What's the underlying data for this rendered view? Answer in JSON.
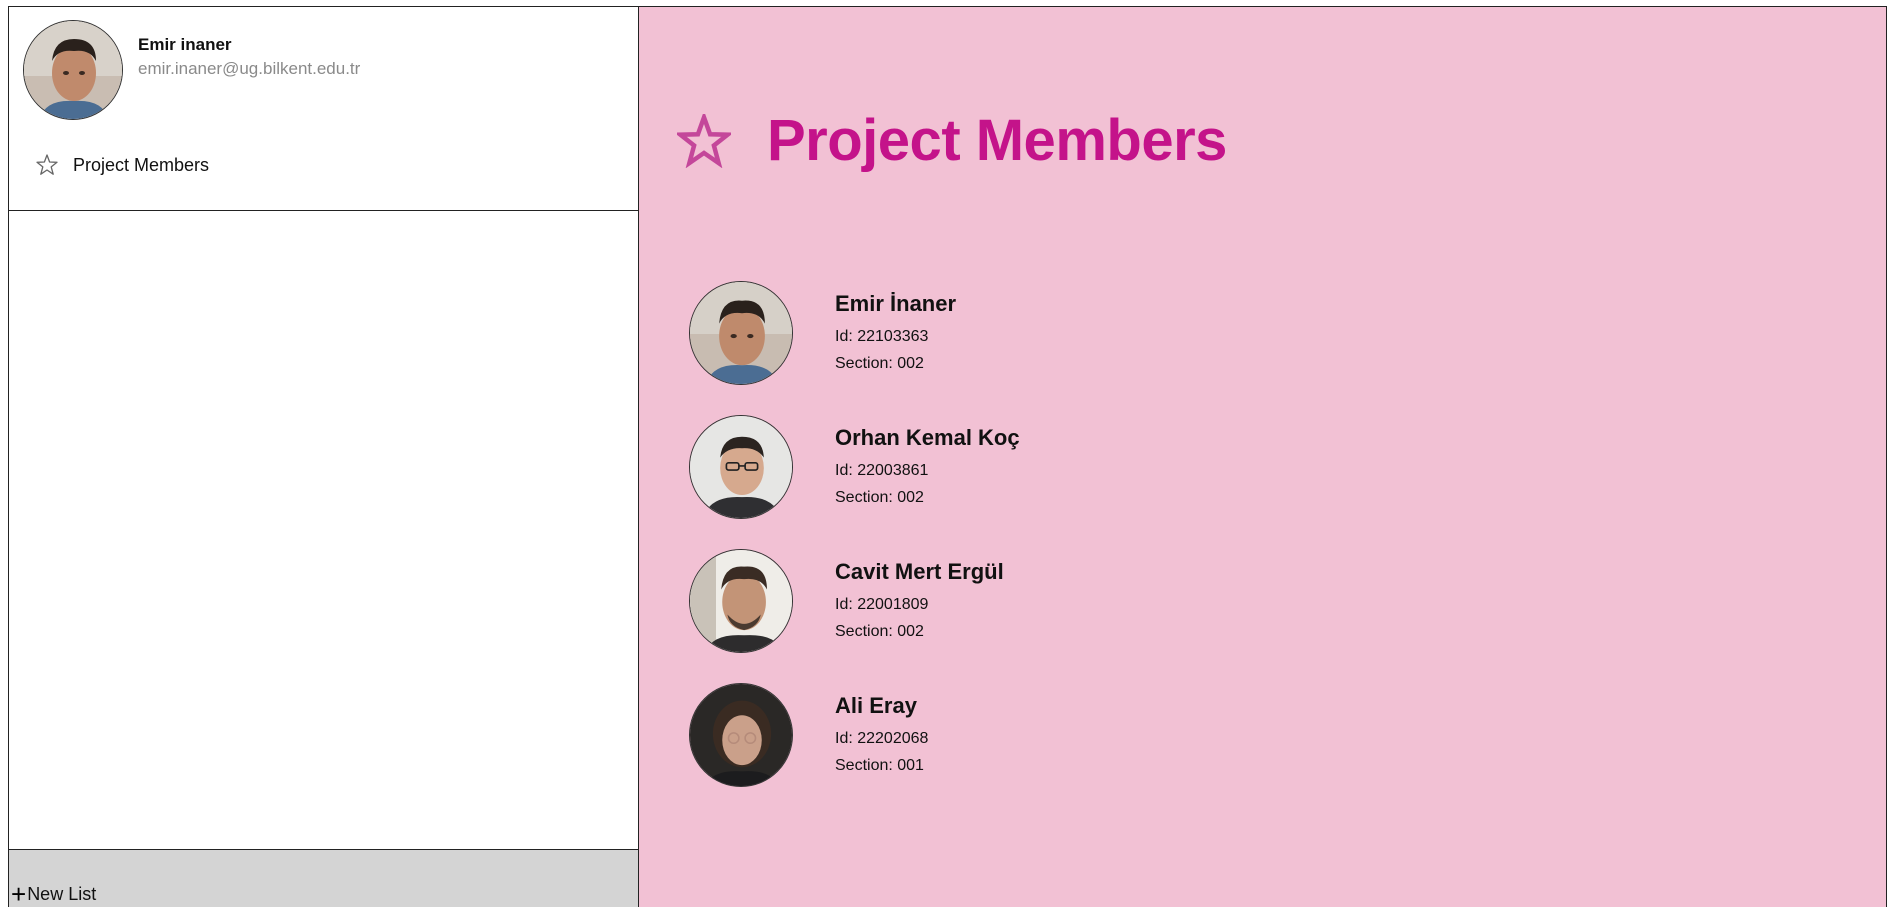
{
  "sidebar": {
    "profile": {
      "name": "Emir inaner",
      "email": "emir.inaner@ug.bilkent.edu.tr",
      "avatar_icon": "user-photo"
    },
    "nav_items": [
      {
        "label": "Project Members",
        "icon": "star-outline-icon"
      }
    ],
    "new_list": {
      "icon": "plus-icon",
      "plus_glyph": "+",
      "label": "New List"
    }
  },
  "main": {
    "title": "Project Members",
    "title_icon": "star-icon",
    "background": "#f2c1d4",
    "title_color": "#c4138a",
    "members": [
      {
        "name": "Emir İnaner",
        "id_line": "Id: 22103363",
        "section_line": "Section: 002"
      },
      {
        "name": "Orhan Kemal Koç",
        "id_line": "Id: 22003861",
        "section_line": "Section: 002"
      },
      {
        "name": "Cavit Mert Ergül",
        "id_line": "Id: 22001809",
        "section_line": "Section: 002"
      },
      {
        "name": "Ali Eray",
        "id_line": "Id: 22202068",
        "section_line": "Section: 001"
      }
    ]
  }
}
